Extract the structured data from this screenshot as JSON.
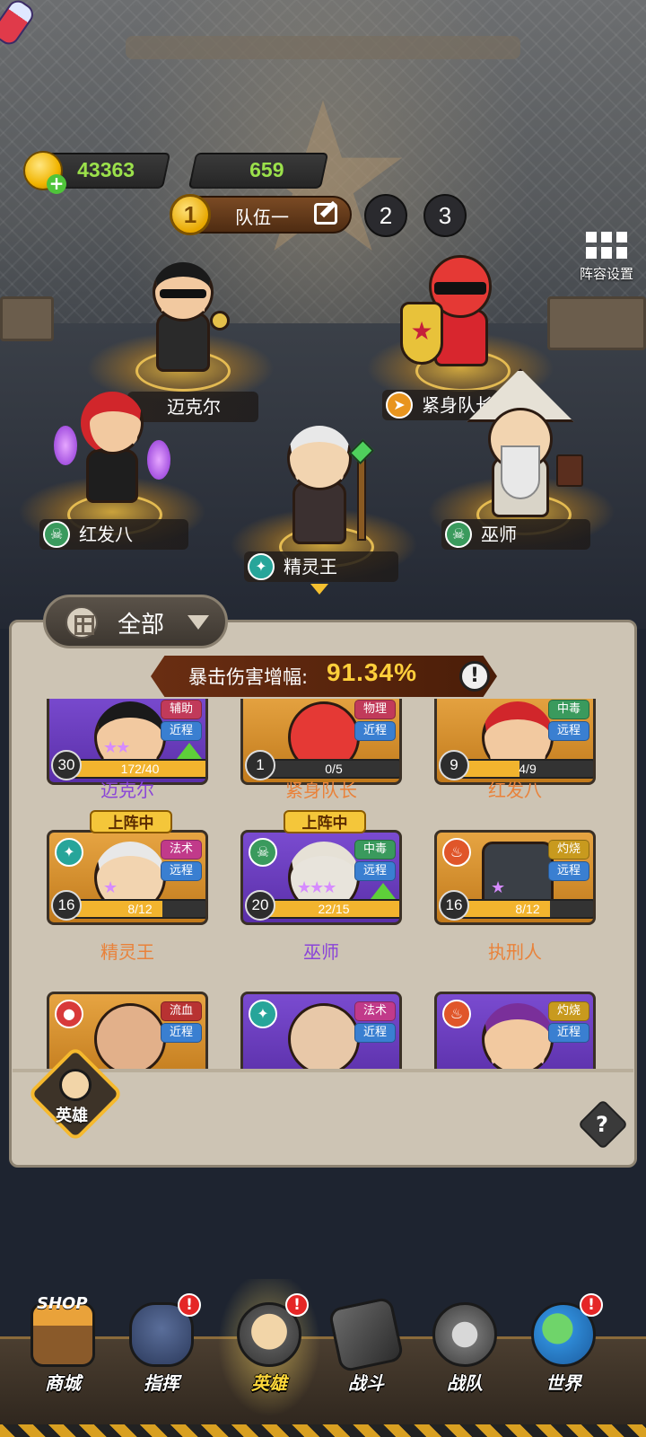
{
  "resources": {
    "gold": "43363",
    "potion": "659"
  },
  "team": {
    "active_number": "1",
    "name": "队伍一",
    "tabs": [
      "2",
      "3"
    ],
    "lineup_settings_label": "阵容设置"
  },
  "stage_heroes": [
    {
      "name": "迈克尔",
      "icon": "none"
    },
    {
      "name": "紧身队长",
      "icon": "shield-charge-icon"
    },
    {
      "name": "红发八",
      "icon": "poison-skull-icon"
    },
    {
      "name": "精灵王",
      "icon": "magic-icon"
    },
    {
      "name": "巫师",
      "icon": "poison-skull-icon"
    }
  ],
  "filter": {
    "label": "全部"
  },
  "crit": {
    "label": "暴击伤害增幅:",
    "value": "91.34%"
  },
  "cards": [
    {
      "name": "迈克尔",
      "level": "30",
      "progress": "172/40",
      "tag1": "辅助",
      "tag2": "近程",
      "stars": "★★",
      "rarity": "purple",
      "upgrade": true,
      "deployed": false,
      "element": ""
    },
    {
      "name": "紧身队长",
      "level": "1",
      "progress": "0/5",
      "tag1": "物理",
      "tag2": "近程",
      "stars": "",
      "rarity": "orange",
      "upgrade": false,
      "deployed": false,
      "element": ""
    },
    {
      "name": "红发八",
      "level": "9",
      "progress": "4/9",
      "tag1": "中毒",
      "tag2": "远程",
      "stars": "",
      "rarity": "orange",
      "upgrade": false,
      "deployed": false,
      "element": ""
    },
    {
      "name": "精灵王",
      "level": "16",
      "progress": "8/12",
      "tag1": "法术",
      "tag2": "远程",
      "stars": "★",
      "rarity": "orange",
      "upgrade": false,
      "deployed": true,
      "element": "magic-icon"
    },
    {
      "name": "巫师",
      "level": "20",
      "progress": "22/15",
      "tag1": "中毒",
      "tag2": "远程",
      "stars": "★★★",
      "rarity": "purple",
      "upgrade": true,
      "deployed": true,
      "element": "poison-skull-icon"
    },
    {
      "name": "执刑人",
      "level": "16",
      "progress": "8/12",
      "tag1": "灼烧",
      "tag2": "远程",
      "stars": "★",
      "rarity": "orange",
      "upgrade": false,
      "deployed": false,
      "element": "fire-icon"
    },
    {
      "name": "",
      "level": "",
      "progress": "",
      "tag1": "流血",
      "tag2": "近程",
      "stars": "",
      "rarity": "orange",
      "upgrade": false,
      "deployed": false,
      "element": "blood-icon"
    },
    {
      "name": "",
      "level": "",
      "progress": "",
      "tag1": "法术",
      "tag2": "近程",
      "stars": "",
      "rarity": "purple",
      "upgrade": false,
      "deployed": false,
      "element": "magic-icon"
    },
    {
      "name": "",
      "level": "",
      "progress": "",
      "tag1": "灼烧",
      "tag2": "近程",
      "stars": "",
      "rarity": "purple",
      "upgrade": false,
      "deployed": false,
      "element": "fire-icon"
    }
  ],
  "deployed_label": "上阵中",
  "panel_tab": {
    "label": "英雄"
  },
  "help": "?",
  "nav": [
    {
      "label": "商城",
      "badge": "",
      "icon": "shop-icon",
      "shop_text": "SHOP"
    },
    {
      "label": "指挥",
      "badge": "!",
      "icon": "commander-hat-icon"
    },
    {
      "label": "英雄",
      "badge": "!",
      "icon": "hero-helmet-icon",
      "active": true
    },
    {
      "label": "战斗",
      "badge": "",
      "icon": "gun-icon"
    },
    {
      "label": "战队",
      "badge": "",
      "icon": "skull-emblem-icon"
    },
    {
      "label": "世界",
      "badge": "!",
      "icon": "globe-icon"
    }
  ],
  "colors": {
    "gold_text": "#9be14b",
    "crit_value": "#ffcf3b",
    "purple_rarity": "#8a44d8",
    "orange_rarity": "#e9823a",
    "badge_red": "#e52626"
  }
}
